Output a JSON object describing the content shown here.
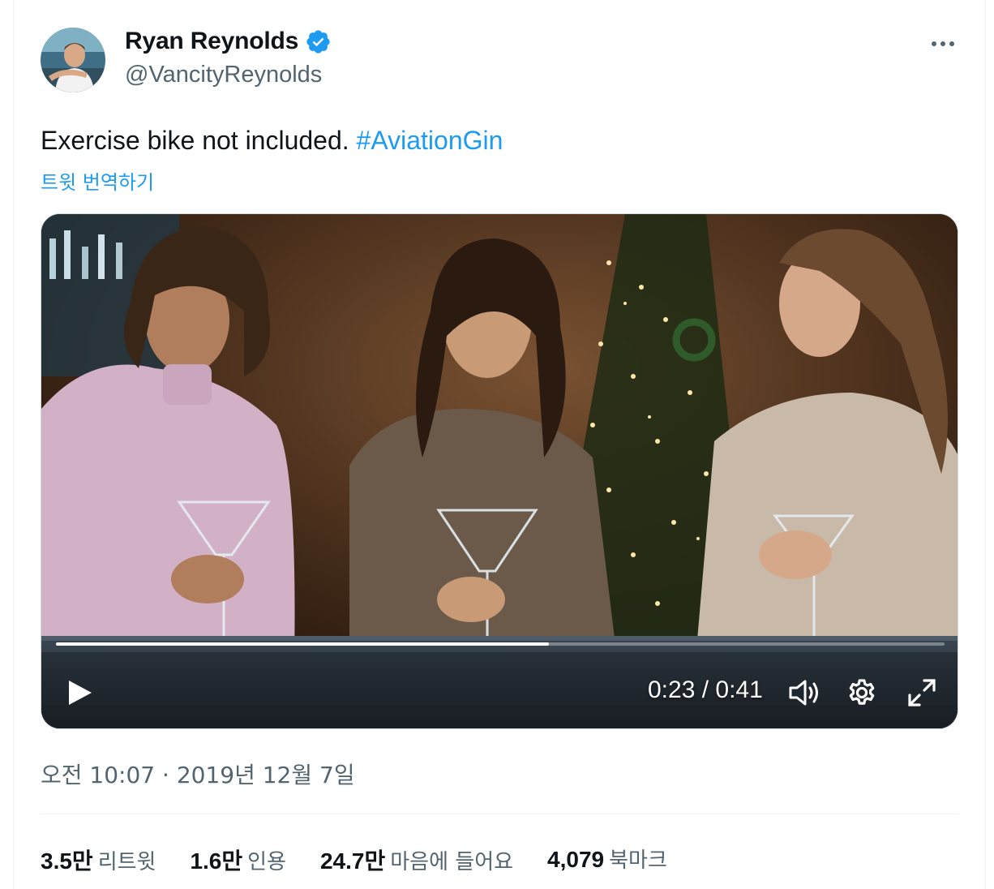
{
  "author": {
    "display_name": "Ryan Reynolds",
    "handle": "@VancityReynolds",
    "verified": true
  },
  "tweet": {
    "text": "Exercise bike not included.",
    "hashtag": "#AviationGin",
    "translate_label": "트윗 번역하기"
  },
  "video": {
    "current_time": "0:23",
    "duration": "0:41",
    "time_display": "0:23 / 0:41",
    "progress_fraction": 0.555
  },
  "timestamp": "오전 10:07 · 2019년 12월 7일",
  "stats": [
    {
      "value": "3.5만",
      "label": "리트윗"
    },
    {
      "value": "1.6만",
      "label": "인용"
    },
    {
      "value": "24.7만",
      "label": "마음에 들어요"
    },
    {
      "value": "4,079",
      "label": "북마크"
    }
  ],
  "colors": {
    "accent": "#1d9bf0",
    "text_primary": "#0f1419",
    "text_secondary": "#536471"
  }
}
